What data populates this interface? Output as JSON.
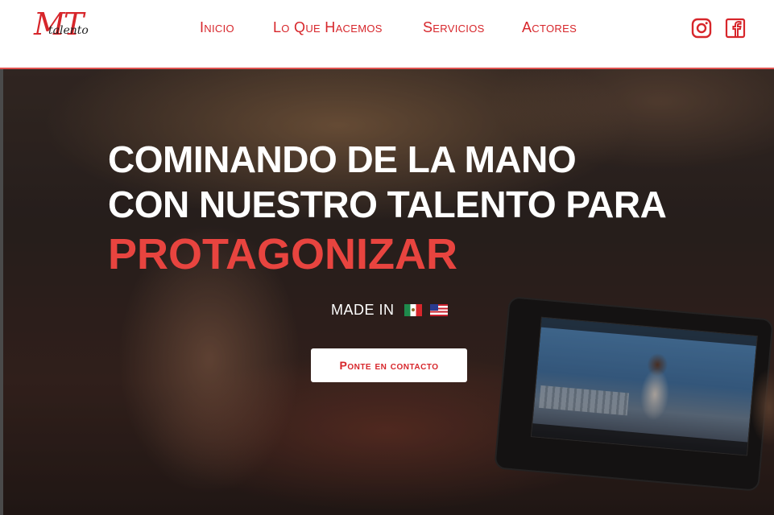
{
  "brand": {
    "logo_mark": "MT",
    "logo_word": "talento",
    "accent_color": "#d7262b",
    "header_bg": "#ffffff"
  },
  "nav": {
    "items": [
      {
        "label": "Inicio"
      },
      {
        "label": "Lo Que Hacemos"
      },
      {
        "label": "Servicios"
      },
      {
        "label": "Actores"
      }
    ]
  },
  "social": {
    "icons": [
      "instagram-icon",
      "facebook-icon"
    ]
  },
  "hero": {
    "headline_line1": "COMINANDO DE LA MANO",
    "headline_line2": "CON NUESTRO TALENTO PARA",
    "headline_accent": "PROTAGONIZAR",
    "accent_color": "#e8443f",
    "made_in_label": "MADE IN",
    "flags": [
      "mexico-flag-icon",
      "usa-flag-icon"
    ],
    "cta_label": "Ponte en contacto"
  }
}
